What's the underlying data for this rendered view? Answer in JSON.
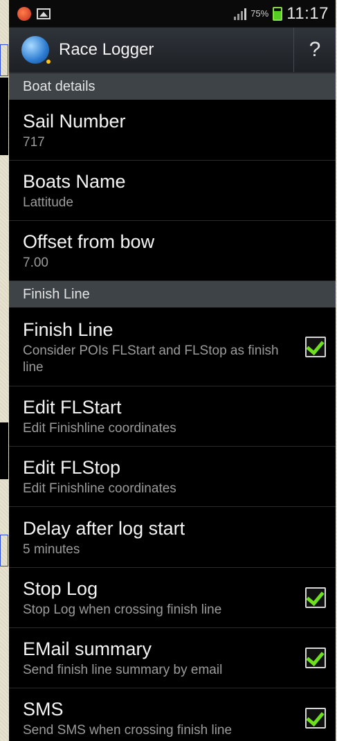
{
  "status_bar": {
    "battery_percent": "75%",
    "time": "11:17"
  },
  "action_bar": {
    "title": "Race Logger",
    "help_label": "?"
  },
  "sections": [
    {
      "header": "Boat details",
      "items": [
        {
          "title": "Sail Number",
          "summary": "717"
        },
        {
          "title": "Boats Name",
          "summary": "Lattitude"
        },
        {
          "title": "Offset from bow",
          "summary": "7.00"
        }
      ]
    },
    {
      "header": "Finish Line",
      "items": [
        {
          "title": "Finish Line",
          "summary": "Consider POIs FLStart and FLStop as finish line",
          "checked": true
        },
        {
          "title": "Edit FLStart",
          "summary": "Edit Finishline coordinates"
        },
        {
          "title": "Edit FLStop",
          "summary": "Edit Finishline coordinates"
        },
        {
          "title": "Delay after log start",
          "summary": "5 minutes"
        },
        {
          "title": "Stop Log",
          "summary": "Stop Log when crossing finish line",
          "checked": true
        },
        {
          "title": "EMail summary",
          "summary": "Send finish line summary by email",
          "checked": true
        },
        {
          "title": "SMS",
          "summary": "Send SMS when crossing finish line",
          "checked": true
        }
      ]
    }
  ],
  "colors": {
    "accent_check": "#6ee01f",
    "category_bg": "#3e4347",
    "action_bar_bg": "#2f343b"
  }
}
